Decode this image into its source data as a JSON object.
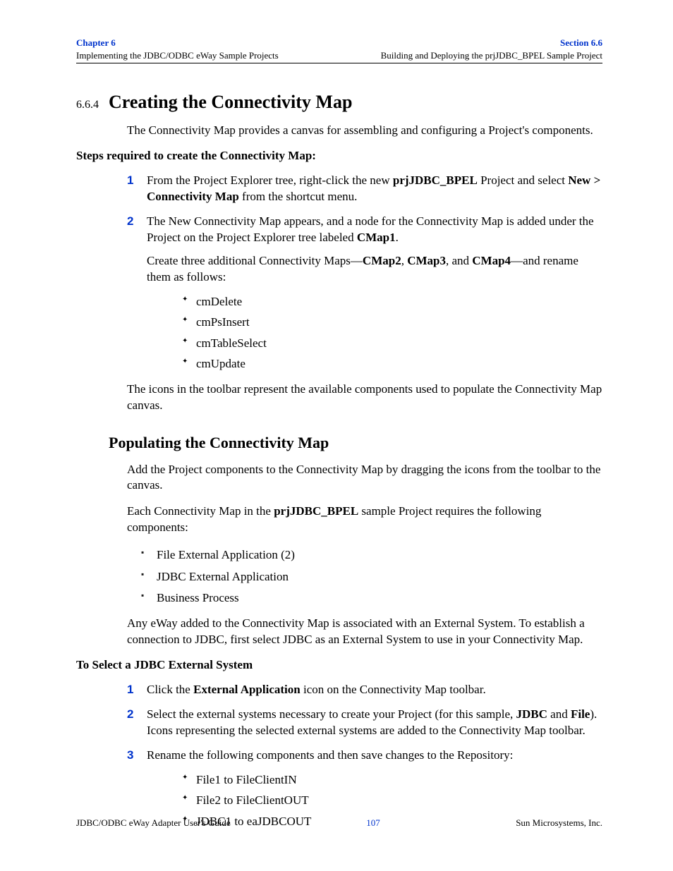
{
  "header": {
    "chapter": "Chapter 6",
    "chapter_sub": "Implementing the JDBC/ODBC eWay Sample Projects",
    "section": "Section 6.6",
    "section_sub": "Building and Deploying the prjJDBC_BPEL Sample Project"
  },
  "title": {
    "number": "6.6.4",
    "text": "Creating the Connectivity Map"
  },
  "intro": "The Connectivity Map provides a canvas for assembling and configuring a Project's components.",
  "steps_heading": "Steps required to create the Connectivity Map:",
  "step1": {
    "pre": "From the Project Explorer tree, right-click the new ",
    "b1": "prjJDBC_BPEL",
    "mid": " Project and select ",
    "b2": "New > Connectivity Map",
    "post": " from the shortcut menu."
  },
  "step2": {
    "p1_pre": "The New Connectivity Map appears, and a node for the Connectivity Map is added under the Project on the Project Explorer tree labeled ",
    "p1_b": "CMap1",
    "p1_post": ".",
    "p2_pre": "Create three additional Connectivity Maps—",
    "p2_b1": "CMap2",
    "p2_sep1": ", ",
    "p2_b2": "CMap3",
    "p2_sep2": ", and ",
    "p2_b3": "CMap4",
    "p2_post": "—and rename them as follows:",
    "items": [
      "cmDelete",
      "cmPsInsert",
      "cmTableSelect",
      "cmUpdate"
    ]
  },
  "after_list": "The icons in the toolbar represent the available components used to populate the Connectivity Map canvas.",
  "sub_title": "Populating the Connectivity Map",
  "pop_p1": "Add the Project components to the Connectivity Map by dragging the icons from the toolbar to the canvas.",
  "pop_p2": {
    "pre": "Each Connectivity Map in the ",
    "b": "prjJDBC_BPEL",
    "post": " sample Project requires the following components:"
  },
  "components": [
    "File External Application (2)",
    "JDBC External Application",
    "Business Process"
  ],
  "pop_p3": "Any eWay added to the Connectivity Map is associated with an External System. To establish a connection to JDBC, first select JDBC as an External System to use in your Connectivity Map.",
  "select_heading": "To Select a JDBC External System",
  "sel1": {
    "pre": "Click the ",
    "b": "External Application",
    "post": " icon on the Connectivity Map toolbar."
  },
  "sel2": {
    "pre": "Select the external systems necessary to create your Project (for this sample, ",
    "b1": "JDBC",
    "mid": " and ",
    "b2": "File",
    "post": "). Icons representing the selected external systems are added to the Connectivity Map toolbar."
  },
  "sel3": {
    "text": "Rename the following components and then save changes to the Repository:",
    "items": [
      "File1 to FileClientIN",
      "File2 to FileClientOUT",
      "JDBC1 to eaJDBCOUT"
    ]
  },
  "footer": {
    "left": "JDBC/ODBC eWay Adapter User's Guide",
    "center": "107",
    "right": "Sun Microsystems, Inc."
  }
}
